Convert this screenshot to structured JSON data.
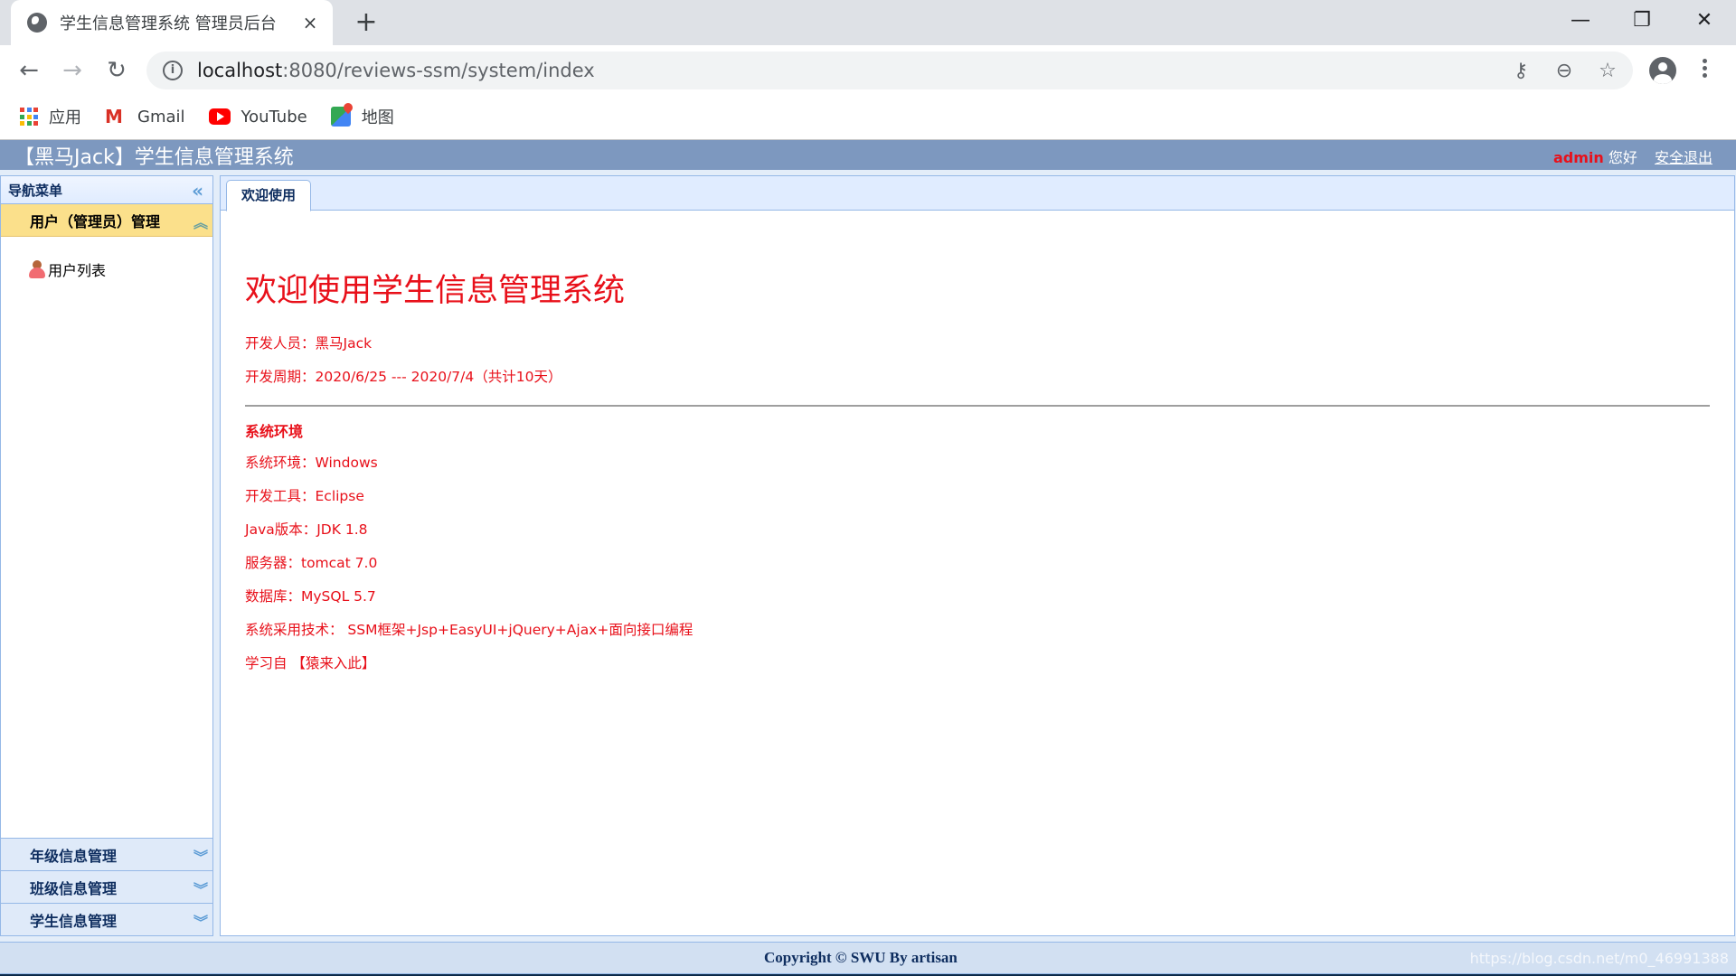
{
  "browser": {
    "tab_title": "学生信息管理系统 管理员后台",
    "tab_close": "×",
    "new_tab": "+",
    "window_controls": {
      "minimize": "—",
      "restore": "❐",
      "close": "✕"
    },
    "nav": {
      "back": "←",
      "forward": "→",
      "reload": "↻"
    },
    "url_host": "localhost",
    "url_rest": ":8080/reviews-ssm/system/index",
    "omnibox_icons": [
      "key-icon",
      "zoom-out-icon",
      "star-icon"
    ],
    "omnibox_glyphs": {
      "key": "⚷",
      "zoom": "⊖",
      "star": "☆"
    },
    "bookmarks": [
      {
        "label": "应用",
        "icon": "apps-icon"
      },
      {
        "label": "Gmail",
        "icon": "gmail-icon"
      },
      {
        "label": "YouTube",
        "icon": "youtube-icon"
      },
      {
        "label": "地图",
        "icon": "maps-icon"
      }
    ]
  },
  "app": {
    "title": "【黑马Jack】学生信息管理系统",
    "user": {
      "name": "admin",
      "greeting": " 您好",
      "logout": "安全退出"
    }
  },
  "sidebar": {
    "title": "导航菜单",
    "collapse_glyph": "«",
    "active_section": {
      "label": "用户（管理员）管理",
      "tool": "︽",
      "items": [
        {
          "label": "用户列表",
          "icon": "user-icon"
        }
      ]
    },
    "sections": [
      {
        "label": "年级信息管理",
        "tool": "︾"
      },
      {
        "label": "班级信息管理",
        "tool": "︾"
      },
      {
        "label": "学生信息管理",
        "tool": "︾"
      }
    ]
  },
  "main": {
    "tabs": [
      {
        "label": "欢迎使用",
        "active": true
      }
    ],
    "welcome": {
      "heading": "欢迎使用学生信息管理系统",
      "developer": "开发人员：黑马Jack",
      "period": "开发周期：2020/6/25 --- 2020/7/4（共计10天）",
      "env_heading": "系统环境",
      "env_lines": [
        "系统环境：Windows",
        "开发工具：Eclipse",
        "Java版本：JDK 1.8",
        "服务器：tomcat 7.0",
        "数据库：MySQL 5.7",
        "系统采用技术： SSM框架+Jsp+EasyUI+jQuery+Ajax+面向接口编程",
        "学习自 【猿来入此】"
      ]
    }
  },
  "footer": {
    "copyright": "Copyright © SWU By artisan",
    "watermark": "https://blog.csdn.net/m0_46991388"
  },
  "colors": {
    "header_bg": "#7d98bf",
    "accent_red": "#e8101a",
    "panel_border": "#95b8e7",
    "active_section_bg": "#fbe08b"
  }
}
